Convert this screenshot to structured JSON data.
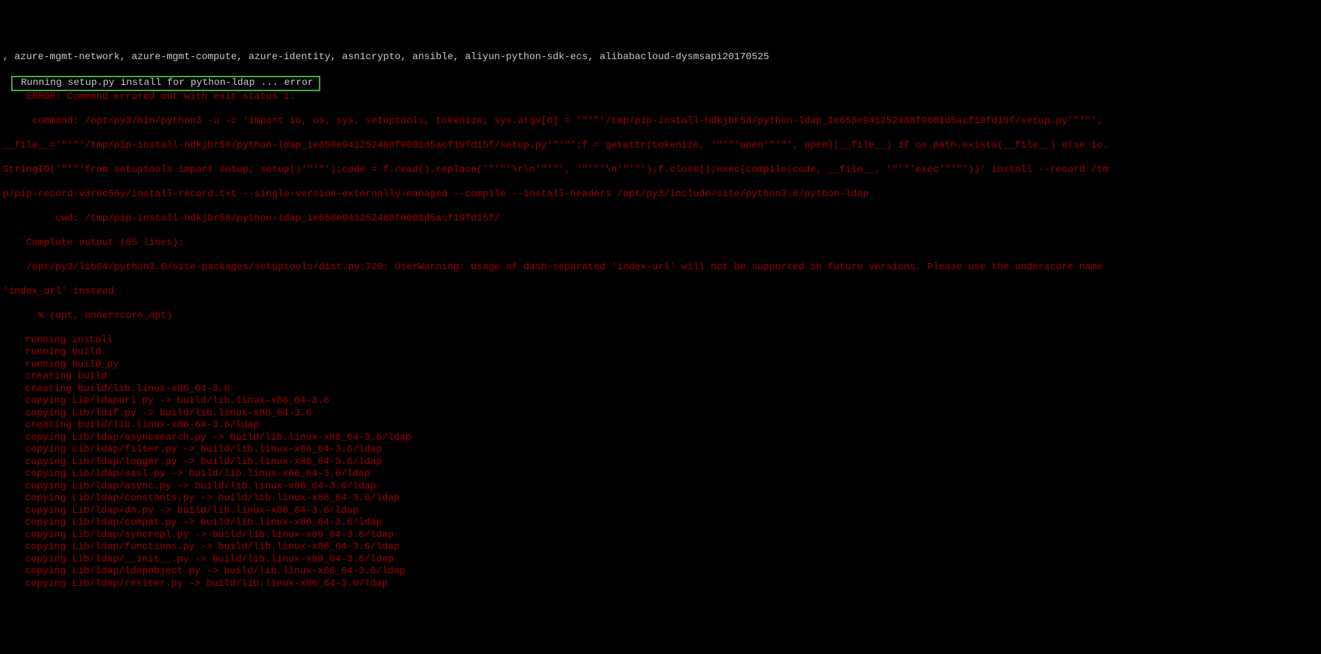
{
  "header": {
    "packages": ", azure-mgmt-network, azure-mgmt-compute, azure-identity, asn1crypto, ansible, aliyun-python-sdk-ecs, alibabacloud-dysmsapi20170525",
    "running": "Running setup.py install for python-ldap ... error"
  },
  "errorBlock": {
    "l1": "    ERROR: Command errored out with exit status 1:",
    "l2": "     command: /opt/py3/bin/python3 -u -c 'import io, os, sys, setuptools, tokenize; sys.argv[0] = '\"'\"'/tmp/pip-install-hdkjbr58/python-ldap_1e658e941252488f9001d5acf19fd15f/setup.py'\"'\"';",
    "l3": "__file__='\"'\"'/tmp/pip-install-hdkjbr58/python-ldap_1e658e941252488f9001d5acf19fd15f/setup.py'\"'\"';f = getattr(tokenize, '\"'\"'open'\"'\"', open)(__file__) if os.path.exists(__file__) else io.",
    "l4": "StringIO('\"'\"'from setuptools import setup; setup()'\"'\"');code = f.read().replace('\"'\"'\\r\\n'\"'\"', '\"'\"'\\n'\"'\"');f.close();exec(compile(code, __file__, '\"'\"'exec'\"'\"'))' install --record /tm",
    "l5": "p/pip-record-v3r9c56y/install-record.txt --single-version-externally-managed --compile --install-headers /opt/py3/include/site/python3.6/python-ldap",
    "l6": "         cwd: /tmp/pip-install-hdkjbr58/python-ldap_1e658e941252488f9001d5acf19fd15f/",
    "l7": "    Complete output (85 lines):",
    "l8": "    /opt/py3/lib64/python3.6/site-packages/setuptools/dist.py:720: UserWarning: Usage of dash-separated 'index-url' will not be supported in future versions. Please use the underscore name ",
    "l9": "'index_url' instead",
    "l10": "      % (opt, underscore_opt)"
  },
  "buildLines": [
    "running install",
    "running build",
    "running build_py",
    "creating build",
    "creating build/lib.linux-x86_64-3.6",
    "copying Lib/ldapurl.py -> build/lib.linux-x86_64-3.6",
    "copying Lib/ldif.py -> build/lib.linux-x86_64-3.6",
    "creating build/lib.linux-x86_64-3.6/ldap",
    "copying Lib/ldap/asyncsearch.py -> build/lib.linux-x86_64-3.6/ldap",
    "copying Lib/ldap/filter.py -> build/lib.linux-x86_64-3.6/ldap",
    "copying Lib/ldap/logger.py -> build/lib.linux-x86_64-3.6/ldap",
    "copying Lib/ldap/sasl.py -> build/lib.linux-x86_64-3.6/ldap",
    "copying Lib/ldap/async.py -> build/lib.linux-x86_64-3.6/ldap",
    "copying Lib/ldap/constants.py -> build/lib.linux-x86_64-3.6/ldap",
    "copying Lib/ldap/dn.py -> build/lib.linux-x86_64-3.6/ldap",
    "copying Lib/ldap/compat.py -> build/lib.linux-x86_64-3.6/ldap",
    "copying Lib/ldap/syncrepl.py -> build/lib.linux-x86_64-3.6/ldap",
    "copying Lib/ldap/functions.py -> build/lib.linux-x86_64-3.6/ldap",
    "copying Lib/ldap/__init__.py -> build/lib.linux-x86_64-3.6/ldap",
    "copying Lib/ldap/ldapobject.py -> build/lib.linux-x86_64-3.6/ldap",
    "copying Lib/ldap/resiter.py -> build/lib.linux-x86_64-3.6/ldap"
  ]
}
